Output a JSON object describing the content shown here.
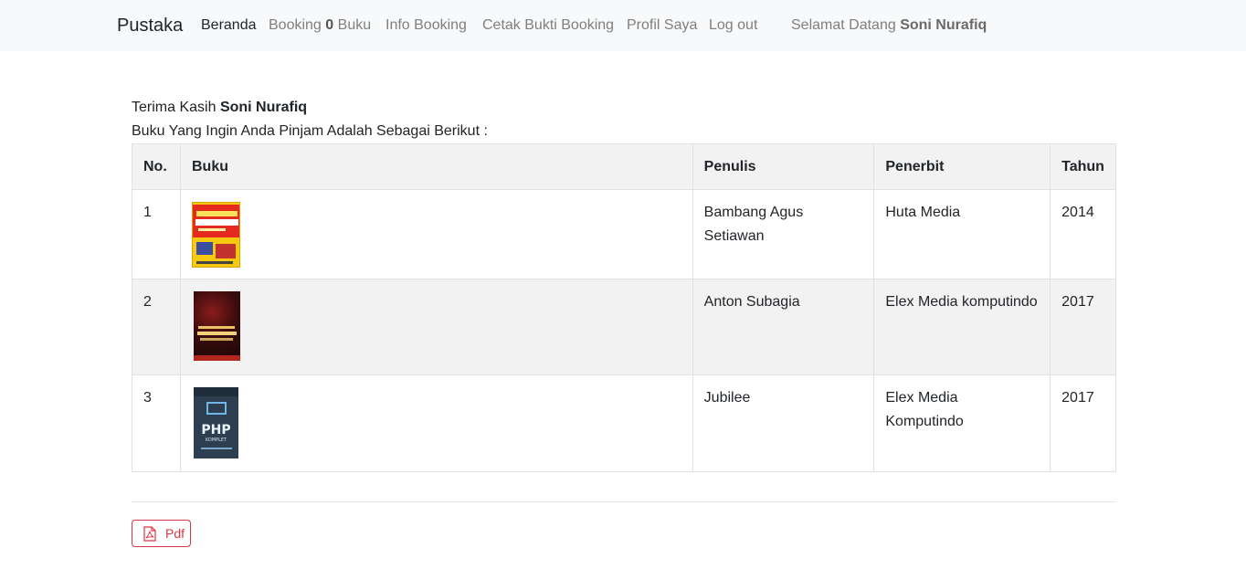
{
  "navbar": {
    "brand": "Pustaka",
    "links": {
      "beranda": "Beranda",
      "booking_prefix": "Booking",
      "booking_count": "0",
      "booking_suffix": "Buku",
      "info_booking": "Info Booking",
      "cetak": "Cetak Bukti Booking",
      "profil": "Profil Saya",
      "logout": "Log out"
    },
    "welcome_prefix": "Selamat Datang",
    "welcome_user": "Soni Nurafiq"
  },
  "main": {
    "thanks_prefix": "Terima Kasih",
    "thanks_user": "Soni Nurafiq",
    "intro": "Buku Yang Ingin Anda Pinjam Adalah Sebagai Berikut :",
    "table": {
      "headers": [
        "No.",
        "Buku",
        "Penulis",
        "Penerbit",
        "Tahun"
      ],
      "rows": [
        {
          "no": "1",
          "cover_icon": "book-cover-belajar-komputer",
          "penulis": "Bambang Agus Setiawan",
          "penerbit": "Huta Media",
          "tahun": "2014"
        },
        {
          "no": "2",
          "cover_icon": "book-cover-dark-red",
          "penulis": "Anton Subagia",
          "penerbit": "Elex Media komputindo",
          "tahun": "2017"
        },
        {
          "no": "3",
          "cover_icon": "book-cover-php-komplet",
          "cover_title": "PHP",
          "cover_subtitle": "KOMPLET",
          "penulis": "Jubilee",
          "penerbit": "Elex Media Komputindo",
          "tahun": "2017"
        }
      ]
    },
    "pdf_button": {
      "label": "Pdf",
      "icon": "file-pdf-icon"
    }
  },
  "colors": {
    "navbar_bg": "#f8f9fa",
    "stripe_bg": "#f2f2f2",
    "danger": "#dc3545"
  }
}
